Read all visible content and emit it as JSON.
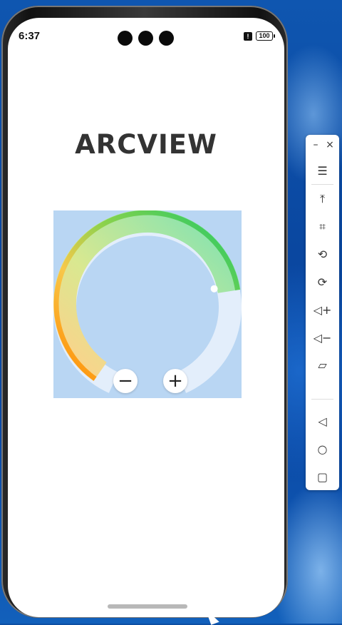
{
  "status_bar": {
    "time": "6:37",
    "alert": "!",
    "battery": "100"
  },
  "app": {
    "title": "ARCVIEW"
  },
  "arc": {
    "value_fraction": 0.78,
    "minus_label": "−",
    "plus_label": "+",
    "track_color": "#e3eefb",
    "background_color": "#b9d6f3",
    "gradient_colors": [
      "#ff8a00",
      "#f8c84a",
      "#8ad24c",
      "#1ec868"
    ]
  },
  "toolbar": {
    "minimize": "–",
    "close": "×",
    "items": [
      {
        "icon": "menu-icon",
        "glyph": "☰"
      },
      {
        "icon": "pin-top-icon",
        "glyph": "⤒"
      },
      {
        "icon": "crop-icon",
        "glyph": "⌗"
      },
      {
        "icon": "rotate-icon",
        "glyph": "⟲"
      },
      {
        "icon": "rotate-alt-icon",
        "glyph": "⟳"
      },
      {
        "icon": "volume-up-icon",
        "glyph": "◁+"
      },
      {
        "icon": "volume-down-icon",
        "glyph": "◁−"
      },
      {
        "icon": "shake-icon",
        "glyph": "▱"
      },
      {
        "icon": "back-icon",
        "glyph": "◁"
      },
      {
        "icon": "home-icon",
        "glyph": "○"
      },
      {
        "icon": "recents-icon",
        "glyph": "▢"
      }
    ]
  }
}
